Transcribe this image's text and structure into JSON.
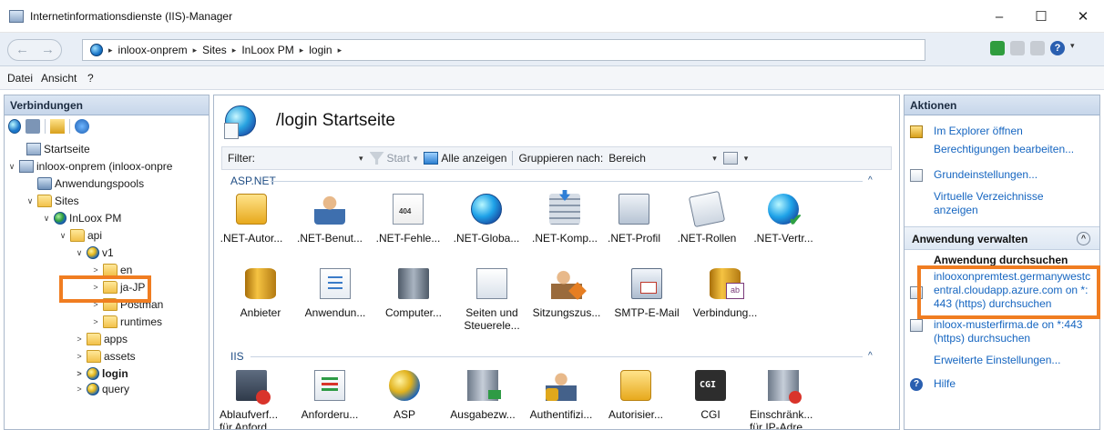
{
  "window": {
    "title": "Internetinformationsdienste (IIS)-Manager",
    "minimize": "–",
    "maximize": "☐",
    "close": "✕"
  },
  "address": {
    "back": "←",
    "forward": "→",
    "crumbs": [
      "inloox-onprem",
      "Sites",
      "InLoox PM",
      "login"
    ],
    "separator": "▸"
  },
  "menu": {
    "items": [
      "Datei",
      "Ansicht",
      "?"
    ]
  },
  "connections": {
    "title": "Verbindungen",
    "tree": [
      {
        "label": "Startseite",
        "icon": "server-icon"
      },
      {
        "label": "inloox-onprem (inloox-onpre",
        "icon": "server-icon",
        "expander": "∨"
      },
      {
        "label": "Anwendungspools",
        "icon": "app-pool-icon"
      },
      {
        "label": "Sites",
        "icon": "folder-icon",
        "expander": "∨"
      },
      {
        "label": "InLoox PM",
        "icon": "globe-icon",
        "expander": "∨"
      },
      {
        "label": "api",
        "icon": "folder-icon",
        "expander": "∨"
      },
      {
        "label": "v1",
        "icon": "application-icon",
        "expander": "∨"
      },
      {
        "label": "en",
        "icon": "folder-icon",
        "expander": ">"
      },
      {
        "label": "ja-JP",
        "icon": "folder-icon",
        "expander": ">"
      },
      {
        "label": "Postman",
        "icon": "folder-icon",
        "expander": ">"
      },
      {
        "label": "runtimes",
        "icon": "folder-icon",
        "expander": ">"
      },
      {
        "label": "apps",
        "icon": "folder-icon",
        "expander": ">"
      },
      {
        "label": "assets",
        "icon": "folder-icon",
        "expander": ">"
      },
      {
        "label": "login",
        "icon": "application-icon",
        "expander": ">"
      },
      {
        "label": "query",
        "icon": "application-icon",
        "expander": ">"
      }
    ]
  },
  "main": {
    "title": "/login Startseite",
    "filter": {
      "label": "Filter:",
      "start": "Start",
      "show_all": "Alle anzeigen",
      "group_by": "Gruppieren nach:",
      "group_value": "Bereich"
    },
    "groups": [
      {
        "title": "ASP.NET",
        "features": [
          {
            "label": ".NET-Autor...",
            "icon": "net-authorization-icon"
          },
          {
            "label": ".NET-Benut...",
            "icon": "net-users-icon"
          },
          {
            "label": ".NET-Fehle...",
            "icon": "net-error-pages-icon"
          },
          {
            "label": ".NET-Globa...",
            "icon": "net-globalization-icon"
          },
          {
            "label": ".NET-Komp...",
            "icon": "net-compilation-icon"
          },
          {
            "label": ".NET-Profil",
            "icon": "net-profile-icon"
          },
          {
            "label": ".NET-Rollen",
            "icon": "net-roles-icon"
          },
          {
            "label": ".NET-Vertr...",
            "icon": "net-trust-icon"
          },
          {
            "label": "Anbieter",
            "icon": "providers-icon"
          },
          {
            "label": "Anwendun...",
            "icon": "app-settings-icon"
          },
          {
            "label": "Computer...",
            "icon": "machine-key-icon"
          },
          {
            "label": "Seiten und Steuerele...",
            "icon": "pages-controls-icon"
          },
          {
            "label": "Sitzungszus...",
            "icon": "session-state-icon"
          },
          {
            "label": "SMTP-E-Mail",
            "icon": "smtp-email-icon"
          },
          {
            "label": "Verbindung...",
            "icon": "connection-strings-icon"
          }
        ]
      },
      {
        "title": "IIS",
        "features": [
          {
            "label": "Ablaufverf... für Anford...",
            "icon": "failed-request-tracing-icon"
          },
          {
            "label": "Anforderu...",
            "icon": "request-filtering-icon"
          },
          {
            "label": "ASP",
            "icon": "asp-icon"
          },
          {
            "label": "Ausgabezw...",
            "icon": "output-caching-icon"
          },
          {
            "label": "Authentifizi...",
            "icon": "authentication-icon"
          },
          {
            "label": "Autorisier...",
            "icon": "authorization-icon"
          },
          {
            "label": "CGI",
            "icon": "cgi-icon"
          },
          {
            "label": "Einschränk... für IP-Adre...",
            "icon": "ip-restrictions-icon"
          }
        ]
      }
    ],
    "collapse_glyph": "^"
  },
  "actions": {
    "title": "Aktionen",
    "items": [
      {
        "label": "Im Explorer öffnen",
        "icon": "explore-icon"
      },
      {
        "label": "Berechtigungen bearbeiten...",
        "icon": ""
      },
      {
        "label": "Grundeinstellungen...",
        "icon": "basic-settings-icon"
      },
      {
        "label": "Virtuelle Verzeichnisse anzeigen",
        "icon": ""
      }
    ],
    "manage": {
      "title": "Anwendung verwalten",
      "collapse": "^",
      "browse_title": "Anwendung durchsuchen",
      "browse_1": "inlooxonpremtest.germanywestcentral.cloudapp.azure.com on *:443 (https) durchsuchen",
      "browse_2": "inloox-musterfirma.de on *:443 (https) durchsuchen",
      "advanced": "Erweiterte Einstellungen..."
    },
    "help": "Hilfe"
  }
}
